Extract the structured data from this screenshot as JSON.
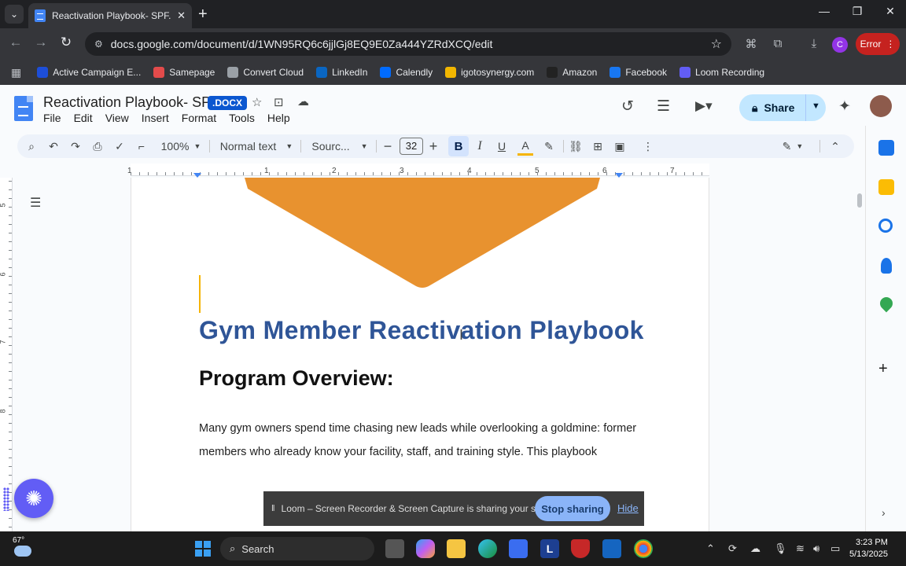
{
  "browser": {
    "tab_title": "Reactivation Playbook- SPF.doc",
    "url": "docs.google.com/document/d/1WN95RQ6c6jjlGj8EQ9E0Za444YZRdXCQ/edit",
    "profile_initial": "C",
    "error_label": "Error",
    "bookmarks": [
      {
        "label": "Active Campaign E...",
        "color": "#1d4ed8"
      },
      {
        "label": "Samepage",
        "color": "#e34b4b"
      },
      {
        "label": "Convert Cloud",
        "color": "#9aa0a6"
      },
      {
        "label": "LinkedIn",
        "color": "#0a66c2"
      },
      {
        "label": "Calendly",
        "color": "#006bff"
      },
      {
        "label": "igotosynergy.com",
        "color": "#f2b600"
      },
      {
        "label": "Amazon",
        "color": "#222222"
      },
      {
        "label": "Facebook",
        "color": "#1877f2"
      },
      {
        "label": "Loom Recording",
        "color": "#625df5"
      }
    ]
  },
  "docs": {
    "title": "Reactivation Playbook- SPF",
    "badge": ".DOCX",
    "menu": [
      "File",
      "Edit",
      "View",
      "Insert",
      "Format",
      "Tools",
      "Help"
    ],
    "share_label": "Share",
    "toolbar": {
      "zoom": "100%",
      "style": "Normal text",
      "font": "Sourc...",
      "font_size": "32",
      "bold": "B",
      "italic": "I",
      "underline": "U",
      "text_color": "A"
    },
    "ruler_numbers": [
      "1",
      "1",
      "2",
      "3",
      "4",
      "5",
      "6",
      "7"
    ],
    "vruler_numbers": [
      "5",
      "6",
      "7",
      "8"
    ]
  },
  "document": {
    "heading": "Gym Member Reactivation Playbook",
    "subheading": "Program Overview:",
    "paragraph": "Many gym owners spend time chasing new leads while overlooking a goldmine: former members who already know your facility, staff, and training style. This playbook",
    "accent_color": "#2f5597",
    "shape_color": "#e8922f"
  },
  "loom": {
    "message": "Loom – Screen Recorder & Screen Capture is sharing your screen.",
    "stop_label": "Stop sharing",
    "hide_label": "Hide"
  },
  "taskbar": {
    "temperature": "67°",
    "search_placeholder": "Search",
    "time": "3:23 PM",
    "date": "5/13/2025"
  }
}
